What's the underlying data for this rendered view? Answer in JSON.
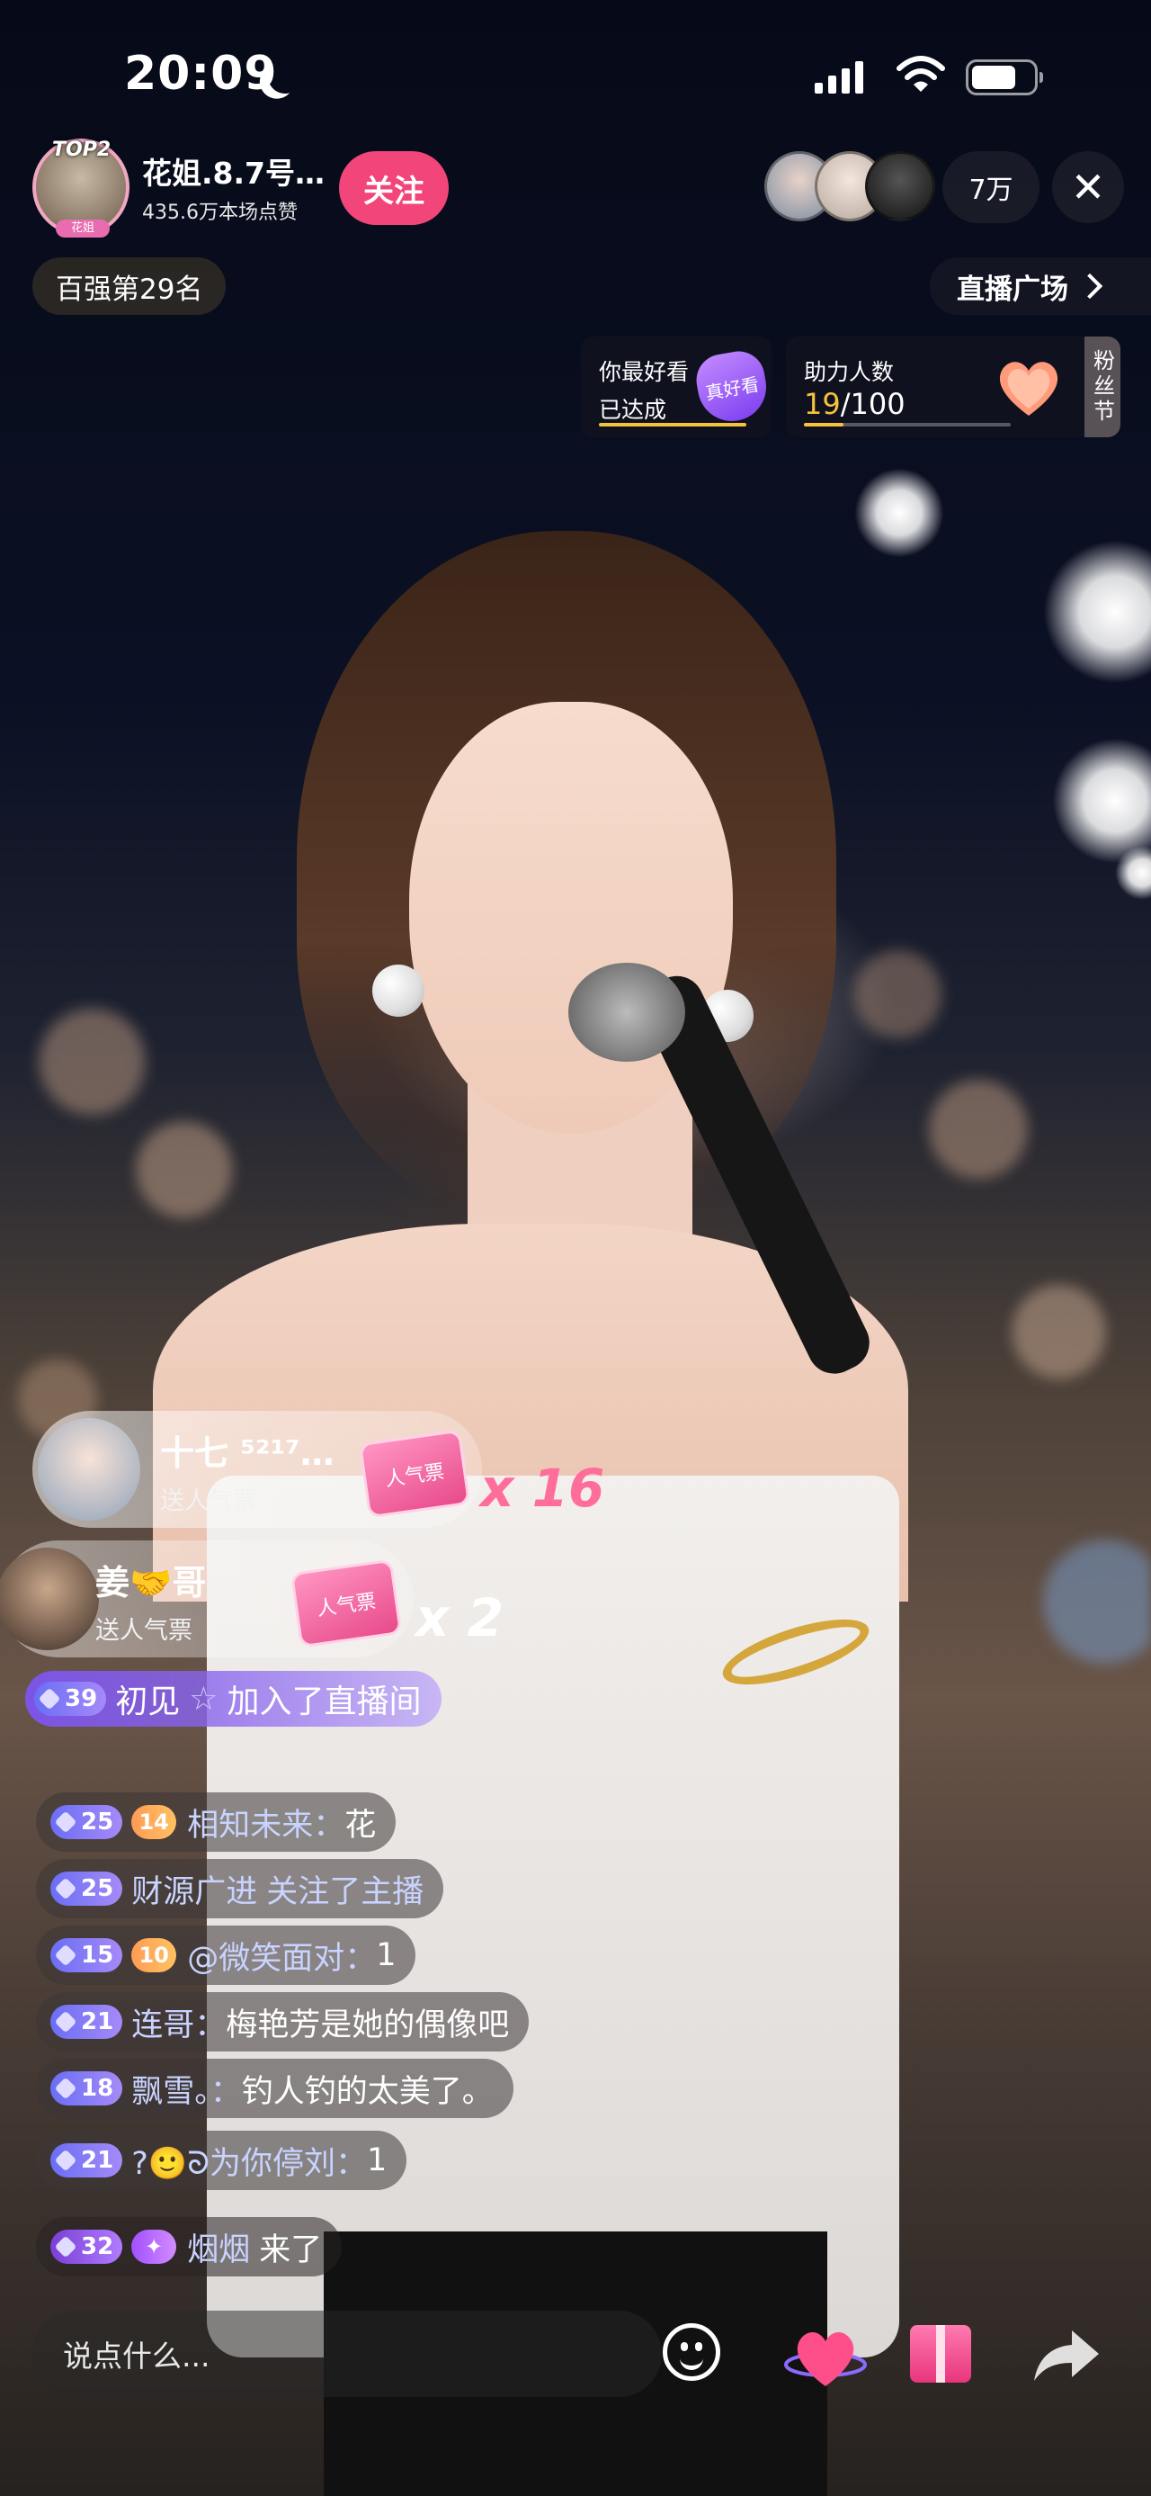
{
  "status_bar": {
    "time": "20:09"
  },
  "host": {
    "badge": "TOP2",
    "avatar_tag": "花姐",
    "name": "花姐.8.7号…",
    "likes": "435.6万本场点赞",
    "follow_label": "关注"
  },
  "top_right": {
    "viewer_count": "7万"
  },
  "rank": {
    "label": "百强第29名"
  },
  "plaza": {
    "label": "直播广场"
  },
  "best_card": {
    "line1": "你最好看",
    "line2": "已达成",
    "badge_text": "真好看"
  },
  "help_card": {
    "line1": "助力人数",
    "current": "19",
    "total": "/100",
    "fans_tab": "粉丝节"
  },
  "gifts": [
    {
      "name": "十七 ⁵²¹⁷…",
      "sub": "送人气票",
      "ticket": "人气票",
      "multiplier": "x 16"
    },
    {
      "name": "姜🤝哥",
      "sub": "送人气票",
      "ticket": "人气票",
      "multiplier": "x 2"
    }
  ],
  "join": {
    "level": "39",
    "nick": "初见",
    "star": "☆",
    "action": "加入了直播间"
  },
  "chat": [
    {
      "level": "25",
      "fan": "14",
      "nick": "相知未来：",
      "text": "花"
    },
    {
      "level": "25",
      "nick": "财源广进",
      "text": "关注了主播"
    },
    {
      "level": "15",
      "fan": "10",
      "nick": "@微笑面对：",
      "text": "1"
    },
    {
      "level": "21",
      "nick": "连哥：",
      "text": "梅艳芳是她的偶像吧"
    },
    {
      "level": "18",
      "nick": "飘雪。：",
      "text": "钓人钓的太美了。"
    },
    {
      "level": "21",
      "nick": "?🙂ᘐ为你停刘：",
      "text": "1"
    },
    {
      "level": "32",
      "fan": "✦",
      "nick": "烟烟",
      "text": "来了"
    }
  ],
  "input": {
    "placeholder": "说点什么..."
  },
  "colors": {
    "follow": "#f2457a",
    "accent_yellow": "#f5c23c",
    "level_badge": "#6a6ef5",
    "multiplier": "#ff6d9a"
  }
}
